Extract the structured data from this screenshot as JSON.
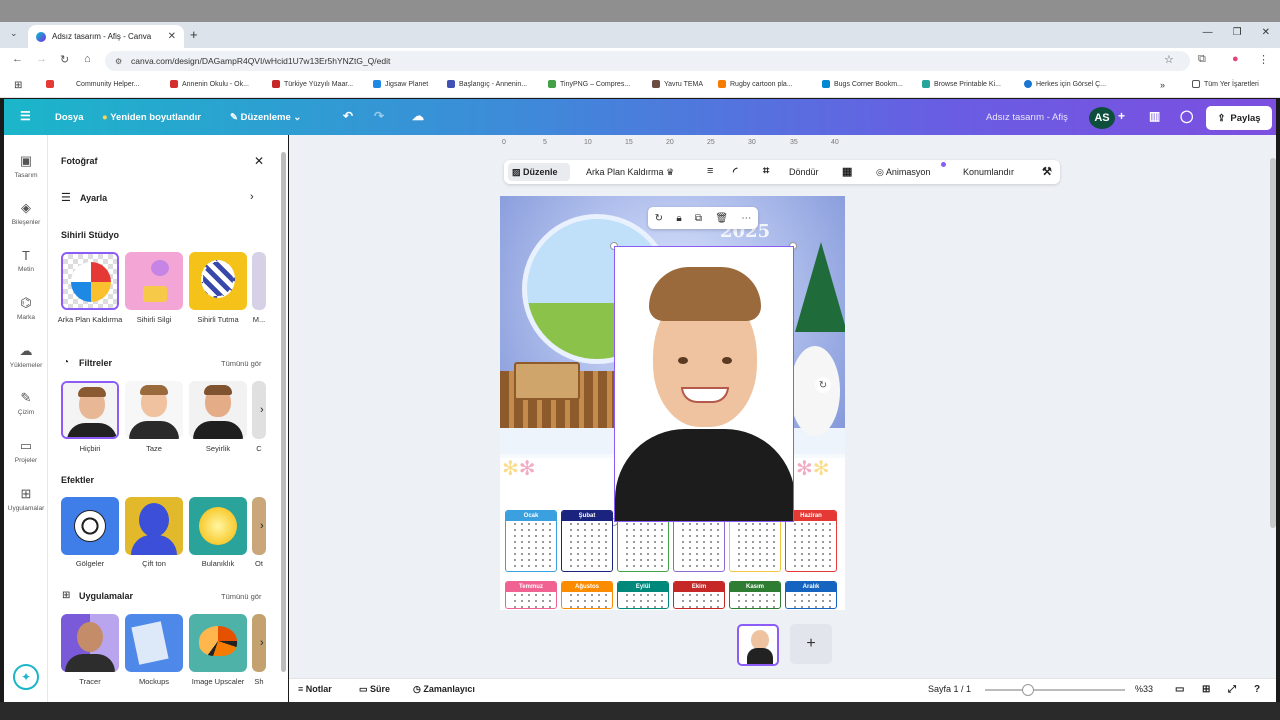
{
  "browser": {
    "tab_title": "Adsız tasarım - Afiş - Canva",
    "url": "canva.com/design/DAGampR4QVI/wHcid1U7w13Er5hYNZtG_Q/edit",
    "bookmarks": [
      "Community Helper...",
      "Annenin Okulu - Ok...",
      "Türkiye Yüzyılı Maar...",
      "Jigsaw Planet",
      "Başlangıç - Annenin...",
      "TinyPNG – Compres...",
      "Yavru TEMA",
      "Rugby cartoon pla...",
      "Bugs Corner Bookm...",
      "Browse Printable Ki...",
      "Herkes için Görsel Ç...",
      "Tüm Yer İşaretleri"
    ]
  },
  "canva_header": {
    "file": "Dosya",
    "resize": "Yeniden boyutlandır",
    "editing": "Düzenleme",
    "doc_title": "Adsız tasarım - Afiş",
    "avatar": "AS",
    "share": "Paylaş"
  },
  "left_rail": [
    "Tasarım",
    "Bileşenler",
    "Metin",
    "Marka",
    "Yüklemeler",
    "Çizim",
    "Projeler",
    "Uygulamalar"
  ],
  "panel": {
    "title": "Fotoğraf",
    "adjust": "Ayarla",
    "magic_studio": "Sihirli Stüdyo",
    "magic_items": [
      "Arka Plan Kaldırma",
      "Sihirli Silgi",
      "Sihirli Tutma",
      "M..."
    ],
    "filters_title": "Filtreler",
    "see_all": "Tümünü gör",
    "filters": [
      "Hiçbiri",
      "Taze",
      "Seyirlik",
      "C"
    ],
    "effects_title": "Efektler",
    "effects": [
      "Gölgeler",
      "Çift ton",
      "Bulanıklık",
      "Ot"
    ],
    "apps_title": "Uygulamalar",
    "apps": [
      "Tracer",
      "Mockups",
      "Image Upscaler",
      "Sh"
    ]
  },
  "context_toolbar": {
    "edit": "Düzenle",
    "bg_remove": "Arka Plan Kaldırma",
    "rotate": "Döndür",
    "animate": "Animasyon",
    "position": "Konumlandır"
  },
  "ruler": [
    "0",
    "5",
    "10",
    "15",
    "20",
    "25",
    "30",
    "35",
    "40"
  ],
  "poster": {
    "year": "2025",
    "months_row1": [
      "Ocak",
      "Şubat",
      "Mart",
      "Nisan",
      "Mayıs",
      "Haziran"
    ],
    "months_row2": [
      "Temmuz",
      "Ağustos",
      "Eylül",
      "Ekim",
      "Kasım",
      "Aralık"
    ],
    "month_colors": [
      "#3aa0e0",
      "#1a237e",
      "#43a047",
      "#8e6bd1",
      "#f5c542",
      "#e53935",
      "#f06292",
      "#fb8c00",
      "#00897b",
      "#c62828",
      "#2e7d32",
      "#1565c0"
    ]
  },
  "bottom_bar": {
    "notes": "Notlar",
    "duration": "Süre",
    "timer": "Zamanlayıcı",
    "page": "Sayfa 1 / 1",
    "zoom": "%33"
  }
}
